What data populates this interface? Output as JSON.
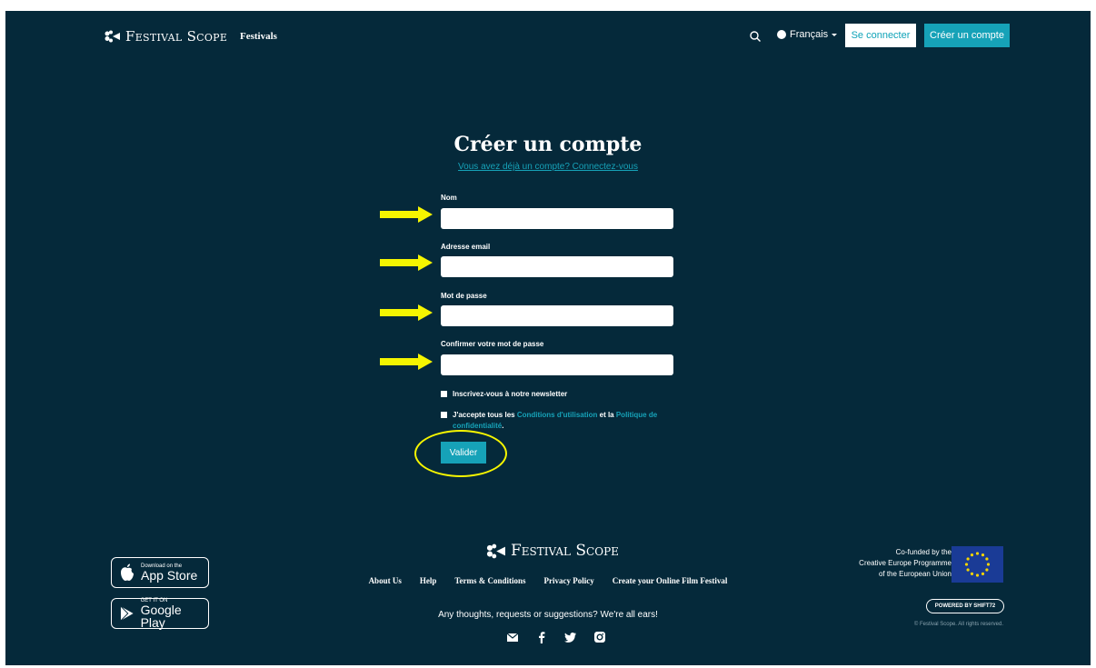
{
  "header": {
    "brand": "Festival Scope",
    "nav_festivals": "Festivals",
    "language": "Français",
    "login_label": "Se connecter",
    "signup_label": "Créer un compte"
  },
  "form": {
    "title": "Créer un compte",
    "login_prompt": "Vous avez déjà un compte? Connectez-vous",
    "fields": [
      {
        "label": "Nom",
        "value": ""
      },
      {
        "label": "Adresse email",
        "value": ""
      },
      {
        "label": "Mot de passe",
        "value": ""
      },
      {
        "label": "Confirmer votre mot de passe",
        "value": ""
      }
    ],
    "newsletter_label": "Inscrivez-vous à notre newsletter",
    "terms_prefix": "J'accepte tous les ",
    "terms_link": "Conditions d'utilisation",
    "terms_middle": " et la ",
    "privacy_link": "Politique de confidentialité",
    "terms_suffix": ".",
    "submit_label": "Valider"
  },
  "footer": {
    "brand": "Festival Scope",
    "links": [
      "About Us",
      "Help",
      "Terms & Conditions",
      "Privacy Policy",
      "Create your Online Film Festival"
    ],
    "tagline": "Any thoughts, requests or suggestions? We're all ears!",
    "app_store_small": "Download on the",
    "app_store_big": "App Store",
    "google_play_small": "GET IT ON",
    "google_play_big": "Google Play",
    "eu_line1": "Co-funded by the",
    "eu_line2": "Creative Europe Programme",
    "eu_line3": "of the European Union",
    "powered_by": "POWERED BY SHIFT72",
    "copyright": "© Festival Scope. All rights reserved."
  },
  "colors": {
    "background": "#05293a",
    "accent": "#16a2b8",
    "annotation": "#f5f500"
  }
}
